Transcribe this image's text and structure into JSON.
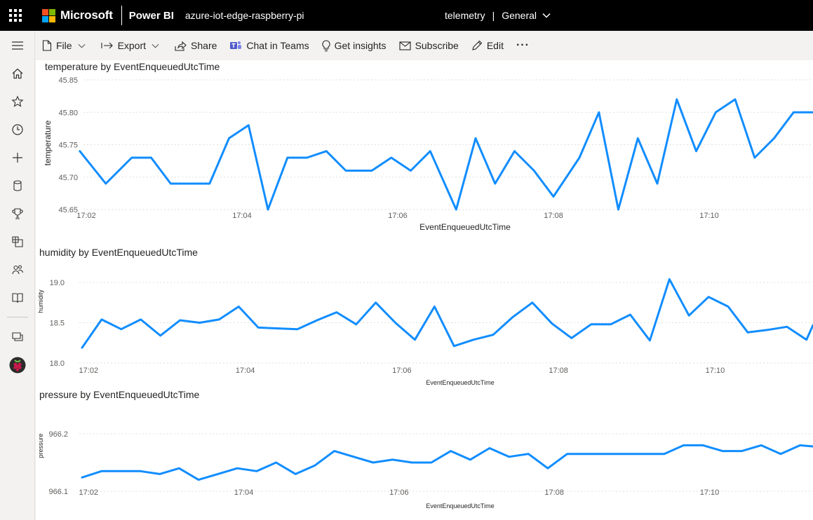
{
  "topbar": {
    "brand": "Microsoft",
    "product": "Power BI",
    "workspace": "azure-iot-edge-raspberry-pi",
    "dataset": "telemetry",
    "separator": "|",
    "sensitivity": "General",
    "brand_colors": [
      "#f25022",
      "#7fba00",
      "#00a4ef",
      "#ffb900"
    ]
  },
  "nav": [
    "hamburger-icon",
    "home-icon",
    "star-icon",
    "clock-icon",
    "plus-icon",
    "database-icon",
    "trophy-icon",
    "apps-icon",
    "people-icon",
    "book-icon",
    "workspaces-icon",
    "raspberry-workspace-icon"
  ],
  "toolbar": {
    "file": "File",
    "export": "Export",
    "share": "Share",
    "teams": "Chat in Teams",
    "insights": "Get insights",
    "subscribe": "Subscribe",
    "edit": "Edit",
    "more": "···"
  },
  "accent_color": "#118dff",
  "visuals": {
    "temperature": {
      "title": "temperature by EventEnqueuedUtcTime"
    },
    "humidity": {
      "title": "humidity by EventEnqueuedUtcTime"
    },
    "pressure": {
      "title": "pressure by EventEnqueuedUtcTime"
    }
  },
  "chart_data": [
    {
      "type": "line",
      "title": "temperature by EventEnqueuedUtcTime",
      "xlabel": "EventEnqueuedUtcTime",
      "ylabel": "temperature",
      "xlim": [
        "17:02",
        "17:11:20"
      ],
      "ylim": [
        45.65,
        45.85
      ],
      "yticks": [
        "45.65",
        "45.70",
        "45.75",
        "45.80",
        "45.85"
      ],
      "xticks": [
        "17:02",
        "17:04",
        "17:06",
        "17:08",
        "17:10"
      ],
      "grid": true,
      "x": [
        "17:01:55",
        "17:02:15",
        "17:02:35",
        "17:02:50",
        "17:03:05",
        "17:03:20",
        "17:03:35",
        "17:03:50",
        "17:04:05",
        "17:04:20",
        "17:04:35",
        "17:04:50",
        "17:05:05",
        "17:05:20",
        "17:05:40",
        "17:05:55",
        "17:06:10",
        "17:06:25",
        "17:06:45",
        "17:07:00",
        "17:07:15",
        "17:07:30",
        "17:07:45",
        "17:08:00",
        "17:08:20",
        "17:08:35",
        "17:08:50",
        "17:09:05",
        "17:09:20",
        "17:09:35",
        "17:09:50",
        "17:10:05",
        "17:10:20",
        "17:10:35",
        "17:10:50",
        "17:11:05",
        "17:11:20",
        "17:11:30"
      ],
      "series": [
        {
          "values": [
            45.74,
            45.69,
            45.73,
            45.73,
            45.69,
            45.69,
            45.69,
            45.76,
            45.78,
            45.65,
            45.73,
            45.73,
            45.74,
            45.71,
            45.71,
            45.73,
            45.71,
            45.74,
            45.65,
            45.76,
            45.69,
            45.74,
            45.71,
            45.67,
            45.73,
            45.8,
            45.65,
            45.76,
            45.69,
            45.82,
            45.74,
            45.8,
            45.82,
            45.73,
            45.76,
            45.8,
            45.8,
            45.79
          ]
        }
      ]
    },
    {
      "type": "line",
      "title": "humidity by EventEnqueuedUtcTime",
      "xlabel": "EventEnqueuedUtcTime",
      "ylabel": "humidity",
      "xlim": [
        "17:01:55",
        "17:11:15"
      ],
      "ylim": [
        18.0,
        19.0
      ],
      "yticks": [
        "18.0",
        "18.5",
        "19.0"
      ],
      "xticks": [
        "17:02",
        "17:04",
        "17:06",
        "17:08",
        "17:10"
      ],
      "grid": true,
      "x": [
        "17:01:55",
        "17:02:10",
        "17:02:25",
        "17:02:40",
        "17:02:55",
        "17:03:10",
        "17:03:25",
        "17:03:40",
        "17:03:55",
        "17:04:10",
        "17:04:25",
        "17:04:40",
        "17:04:55",
        "17:05:10",
        "17:05:25",
        "17:05:40",
        "17:05:55",
        "17:06:10",
        "17:06:25",
        "17:06:40",
        "17:06:55",
        "17:07:10",
        "17:07:25",
        "17:07:40",
        "17:07:55",
        "17:08:10",
        "17:08:25",
        "17:08:40",
        "17:08:55",
        "17:09:10",
        "17:09:25",
        "17:09:40",
        "17:09:55",
        "17:10:10",
        "17:10:25",
        "17:10:40",
        "17:10:55",
        "17:11:10",
        "17:11:15"
      ],
      "series": [
        {
          "values": [
            18.19,
            18.54,
            18.42,
            18.54,
            18.34,
            18.53,
            18.5,
            18.54,
            18.7,
            18.44,
            18.43,
            18.42,
            18.53,
            18.63,
            18.48,
            18.75,
            18.5,
            18.29,
            18.7,
            18.21,
            18.29,
            18.35,
            18.57,
            18.75,
            18.49,
            18.31,
            18.48,
            18.48,
            18.6,
            18.28,
            19.04,
            18.59,
            18.82,
            18.7,
            18.38,
            18.41,
            18.45,
            18.29,
            18.47
          ]
        }
      ]
    },
    {
      "type": "line",
      "title": "pressure by EventEnqueuedUtcTime",
      "xlabel": "EventEnqueuedUtcTime",
      "ylabel": "pressure",
      "xlim": [
        "17:01:55",
        "17:11:20"
      ],
      "ylim": [
        966.1,
        966.2
      ],
      "yticks": [
        "966.1",
        "966.2"
      ],
      "xticks": [
        "17:02",
        "17:04",
        "17:06",
        "17:08",
        "17:10"
      ],
      "grid": true,
      "x": [
        "17:01:55",
        "17:02:10",
        "17:02:25",
        "17:02:40",
        "17:02:55",
        "17:03:10",
        "17:03:25",
        "17:03:40",
        "17:03:55",
        "17:04:10",
        "17:04:25",
        "17:04:40",
        "17:04:55",
        "17:05:10",
        "17:05:25",
        "17:05:40",
        "17:05:55",
        "17:06:10",
        "17:06:25",
        "17:06:40",
        "17:06:55",
        "17:07:10",
        "17:07:25",
        "17:07:40",
        "17:07:55",
        "17:08:10",
        "17:08:25",
        "17:08:40",
        "17:08:55",
        "17:09:10",
        "17:09:25",
        "17:09:40",
        "17:09:55",
        "17:10:10",
        "17:10:25",
        "17:10:40",
        "17:10:55",
        "17:11:10",
        "17:11:20"
      ],
      "series": [
        {
          "values": [
            966.124,
            966.135,
            966.135,
            966.135,
            966.13,
            966.14,
            966.12,
            966.13,
            966.14,
            966.135,
            966.15,
            966.13,
            966.145,
            966.17,
            966.16,
            966.15,
            966.155,
            966.15,
            966.15,
            966.17,
            966.155,
            966.175,
            966.16,
            966.165,
            966.14,
            966.165,
            966.165,
            966.165,
            966.165,
            966.165,
            966.165,
            966.18,
            966.18,
            966.17,
            966.17,
            966.18,
            966.165,
            966.18,
            966.178
          ]
        }
      ]
    }
  ]
}
